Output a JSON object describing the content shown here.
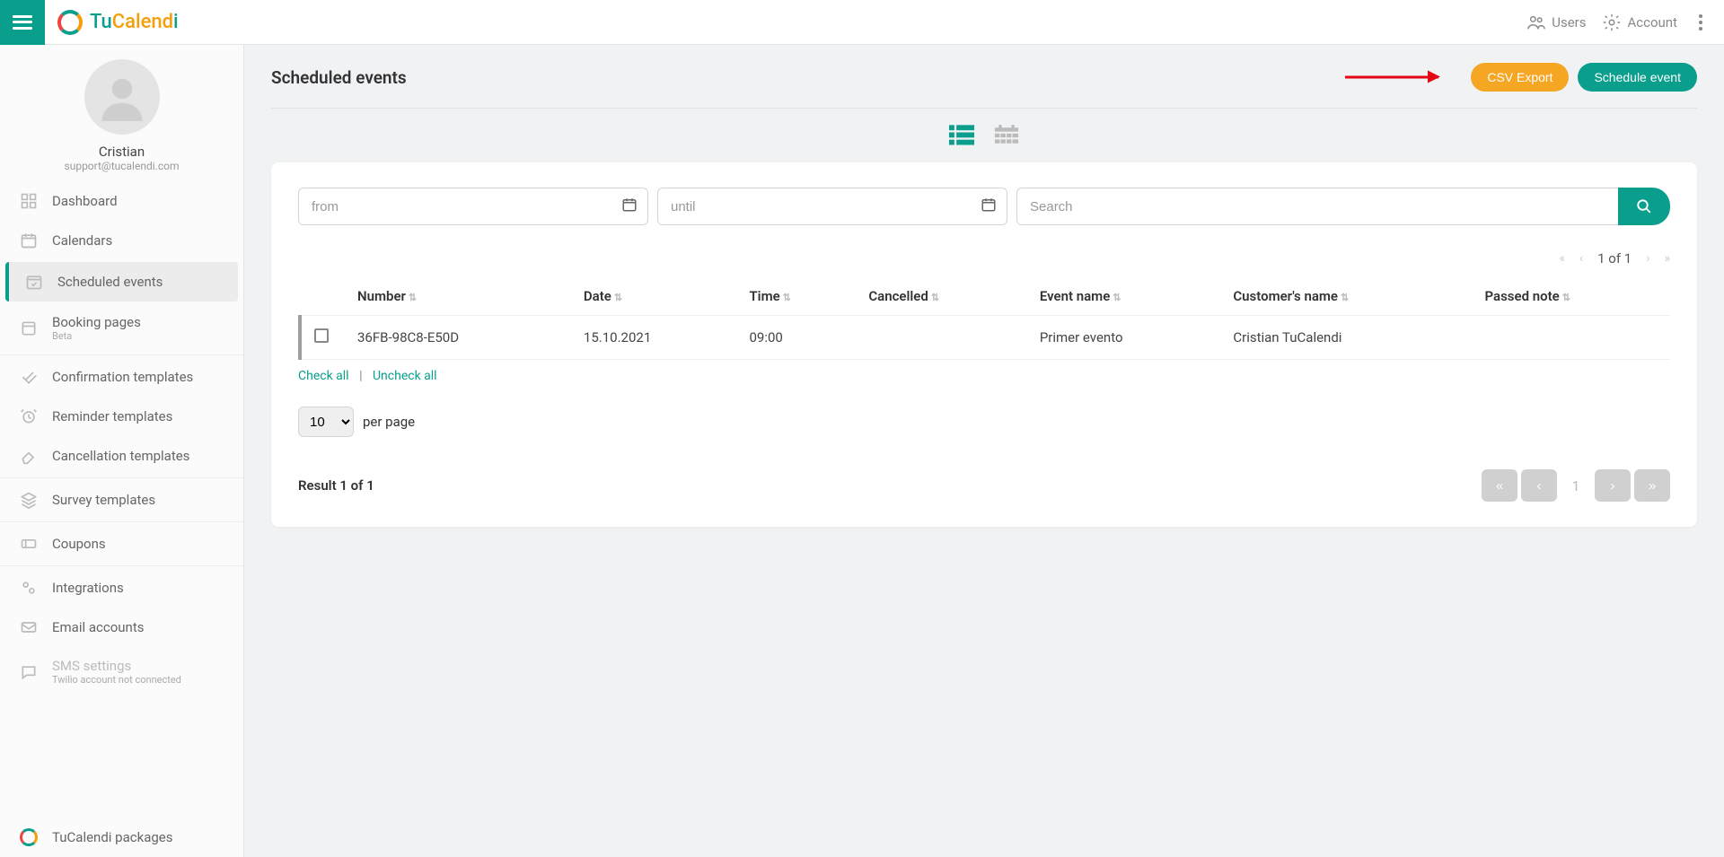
{
  "brand": {
    "tu": "Tu",
    "calend": "Calend",
    "i": "i"
  },
  "top": {
    "users": "Users",
    "account": "Account"
  },
  "profile": {
    "name": "Cristian",
    "email": "support@tucalendi.com"
  },
  "sidebar": {
    "dashboard": "Dashboard",
    "calendars": "Calendars",
    "scheduled": "Scheduled events",
    "booking": "Booking pages",
    "booking_badge": "Beta",
    "confirmation": "Confirmation templates",
    "reminder": "Reminder templates",
    "cancellation": "Cancellation templates",
    "survey": "Survey templates",
    "coupons": "Coupons",
    "integrations": "Integrations",
    "email": "Email accounts",
    "sms": "SMS settings",
    "sms_sub": "Twilio account not connected",
    "packages": "TuCalendi packages"
  },
  "page": {
    "title": "Scheduled events",
    "csv": "CSV Export",
    "schedule": "Schedule event"
  },
  "filters": {
    "from": "from",
    "until": "until",
    "search": "Search"
  },
  "pager_top": "1 of 1",
  "table": {
    "headers": {
      "number": "Number",
      "date": "Date",
      "time": "Time",
      "cancelled": "Cancelled",
      "event": "Event name",
      "customer": "Customer's name",
      "passed": "Passed note"
    },
    "rows": [
      {
        "number": "36FB-98C8-E50D",
        "date": "15.10.2021",
        "time": "09:00",
        "cancelled": "",
        "event": "Primer evento",
        "customer": "Cristian TuCalendi",
        "passed": ""
      }
    ]
  },
  "links": {
    "check_all": "Check all",
    "uncheck_all": "Uncheck all"
  },
  "perpage": {
    "value": "10",
    "label": "per page"
  },
  "result": "Result 1 of 1",
  "footer_page": "1"
}
